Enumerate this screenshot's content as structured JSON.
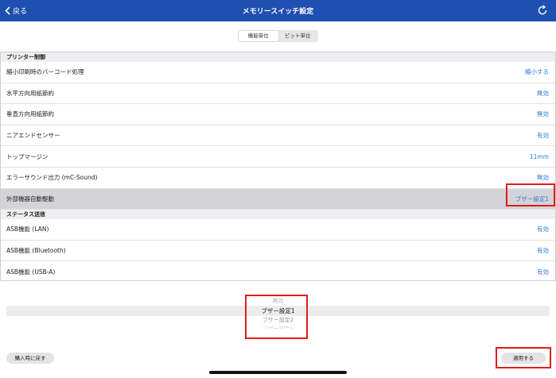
{
  "nav": {
    "back_label": "戻る",
    "title": "メモリースイッチ設定"
  },
  "segment": [
    "機能単位",
    "ビット単位"
  ],
  "sections": [
    {
      "title": "プリンター制御",
      "rows": [
        {
          "label": "縮小印刷時のバーコード処理",
          "value": "縮小する"
        },
        {
          "label": "水平方向用紙節約",
          "value": "無効"
        },
        {
          "label": "垂直方向用紙節約",
          "value": "無効"
        },
        {
          "label": "ニアエンドセンサー",
          "value": "有効"
        },
        {
          "label": "トップマージン",
          "value": "11mm"
        },
        {
          "label": "エラーサウンド出力 (mC-Sound)",
          "value": "無効"
        },
        {
          "label": "外部機器自動駆動",
          "value": "ブザー設定1"
        }
      ]
    },
    {
      "title": "ステータス送信",
      "rows": [
        {
          "label": "ASB機能 (LAN)",
          "value": "有効"
        },
        {
          "label": "ASB機能 (Bluetooth)",
          "value": "有効"
        },
        {
          "label": "ASB機能 (USB-A)",
          "value": "有効"
        }
      ]
    }
  ],
  "picker": {
    "options": [
      "無効",
      "ブザー設定1",
      "ブザー設定2",
      "ブザー設定3"
    ],
    "selected": "ブザー設定1"
  },
  "buttons": {
    "reset": "購入時に戻す",
    "apply": "適用する"
  },
  "colors": {
    "nav_bg": "#1f4fb0",
    "value_blue": "#2f7ad6",
    "highlight_red": "#e01b1b"
  }
}
